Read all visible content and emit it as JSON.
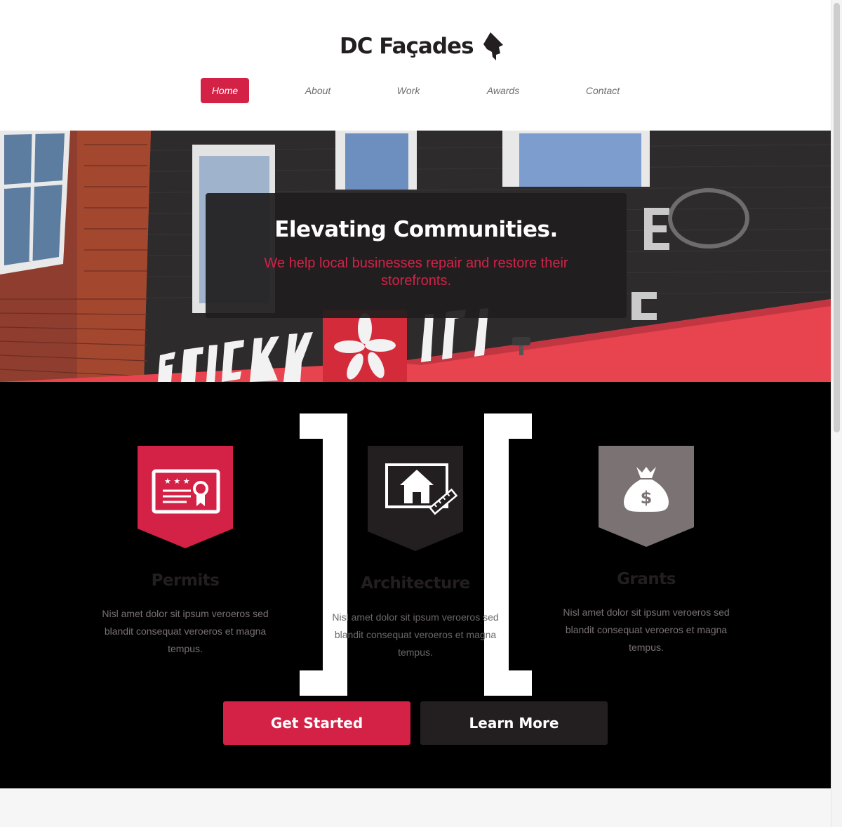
{
  "brand": {
    "name": "DC Façades",
    "accent": "#d42247",
    "dark": "#231f20",
    "gray": "#7a7273"
  },
  "nav": {
    "items": [
      {
        "label": "Home",
        "active": true
      },
      {
        "label": "About",
        "active": false
      },
      {
        "label": "Work",
        "active": false
      },
      {
        "label": "Awards",
        "active": false
      },
      {
        "label": "Contact",
        "active": false
      }
    ]
  },
  "hero": {
    "title": "Elevating Communities.",
    "subtitle": "We help local businesses repair and restore their storefronts.",
    "background_icon": "storefront-photo"
  },
  "features": [
    {
      "title": "Permits",
      "text": "Nisl amet dolor sit ipsum veroeros sed blandit consequat veroeros et magna tempus.",
      "icon": "certificate-icon",
      "color": "#d42247"
    },
    {
      "title": "Architecture",
      "text": "Nisl amet dolor sit ipsum veroeros sed blandit consequat veroeros et magna tempus.",
      "icon": "house-blueprint-icon",
      "color": "#231f20"
    },
    {
      "title": "Grants",
      "text": "Nisl amet dolor sit ipsum veroeros sed blandit consequat veroeros et magna tempus.",
      "icon": "money-bag-icon",
      "color": "#7a7273"
    }
  ],
  "actions": {
    "primary": "Get Started",
    "secondary": "Learn More"
  }
}
